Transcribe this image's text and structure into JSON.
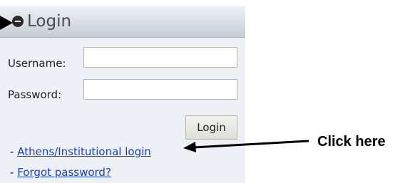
{
  "panel": {
    "title": "Login",
    "icon": "collapse-icon"
  },
  "form": {
    "username_label": "Username:",
    "username_value": "",
    "password_label": "Password:",
    "password_value": "",
    "login_button": "Login"
  },
  "links": [
    {
      "bullet": "-",
      "label": "Athens/Institutional login"
    },
    {
      "bullet": "-",
      "label": "Forgot password?"
    }
  ],
  "callout": {
    "text": "Click here"
  }
}
